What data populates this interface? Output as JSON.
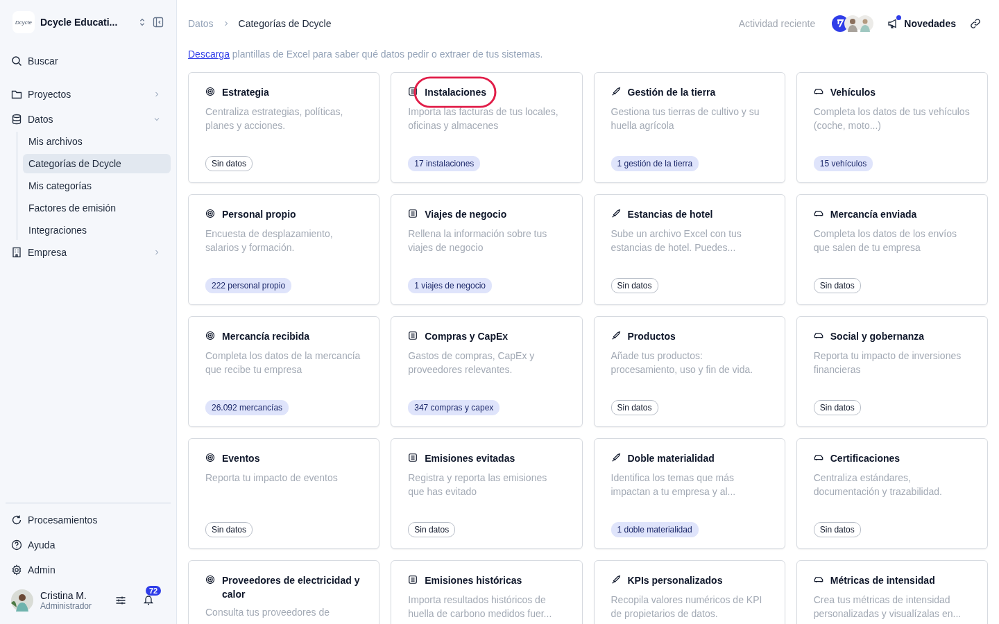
{
  "sidebar": {
    "workspace": {
      "logo": "Dcycle",
      "name": "Dcycle Educati..."
    },
    "search": "Buscar",
    "items": [
      {
        "label": "Proyectos",
        "expanded": false
      },
      {
        "label": "Datos",
        "expanded": true,
        "children": [
          {
            "label": "Mis archivos",
            "selected": false
          },
          {
            "label": "Categorías de Dcycle",
            "selected": true
          },
          {
            "label": "Mis categorías",
            "selected": false
          },
          {
            "label": "Factores de emisión",
            "selected": false
          },
          {
            "label": "Integraciones",
            "selected": false
          }
        ]
      },
      {
        "label": "Empresa",
        "expanded": false
      }
    ],
    "footer_items": [
      "Procesamientos",
      "Ayuda",
      "Admin"
    ],
    "user": {
      "name": "Cristina M.",
      "role": "Administrador",
      "notifications": "72"
    }
  },
  "breadcrumb": [
    "Datos",
    "Categorías de Dcycle"
  ],
  "header": {
    "activity": "Actividad reciente",
    "news": "Novedades",
    "news_unread": true
  },
  "notice": {
    "link": "Descarga",
    "text": " plantillas de Excel para saber qué datos pedir o extraer de tus sistemas."
  },
  "cards": [
    {
      "title": "Estrategia",
      "description": "Centraliza estrategias, políticas, planes y acciones.",
      "status": "Sin datos",
      "has_data": false
    },
    {
      "title": "Instalaciones",
      "description": "Importa las facturas de tus locales, oficinas y almacenes",
      "status": "17 instalaciones",
      "has_data": true,
      "highlighted": true
    },
    {
      "title": "Gestión de la tierra",
      "description": "Gestiona tus tierras de cultivo y su huella agrícola",
      "status": "1 gestión de la tierra",
      "has_data": true
    },
    {
      "title": "Vehículos",
      "description": "Completa los datos de tus vehículos (coche, moto...)",
      "status": "15 vehículos",
      "has_data": true
    },
    {
      "title": "Personal propio",
      "description": "Encuesta de desplazamiento, salarios y formación.",
      "status": "222 personal propio",
      "has_data": true
    },
    {
      "title": "Viajes de negocio",
      "description": "Rellena la información sobre tus viajes de negocio",
      "status": "1 viajes de negocio",
      "has_data": true
    },
    {
      "title": "Estancias de hotel",
      "description": "Sube un archivo Excel con tus estancias de hotel. Puedes...",
      "status": "Sin datos",
      "has_data": false
    },
    {
      "title": "Mercancía enviada",
      "description": "Completa los datos de los envíos que salen de tu empresa",
      "status": "Sin datos",
      "has_data": false
    },
    {
      "title": "Mercancía recibida",
      "description": "Completa los datos de la mercancía que recibe tu empresa",
      "status": "26.092 mercancías",
      "has_data": true
    },
    {
      "title": "Compras y CapEx",
      "description": "Gastos de compras, CapEx y proveedores relevantes.",
      "status": "347 compras y capex",
      "has_data": true
    },
    {
      "title": "Productos",
      "description": "Añade tus productos: procesamiento, uso y fin de vida.",
      "status": "Sin datos",
      "has_data": false
    },
    {
      "title": "Social y gobernanza",
      "description": "Reporta tu impacto de inversiones financieras",
      "status": "Sin datos",
      "has_data": false
    },
    {
      "title": "Eventos",
      "description": "Reporta tu impacto de eventos",
      "status": "Sin datos",
      "has_data": false
    },
    {
      "title": "Emisiones evitadas",
      "description": "Registra y reporta las emisiones que has evitado",
      "status": "Sin datos",
      "has_data": false
    },
    {
      "title": "Doble materialidad",
      "description": "Identifica los temas que más impactan a tu empresa y al...",
      "status": "1 doble materialidad",
      "has_data": true
    },
    {
      "title": "Certificaciones",
      "description": "Centraliza estándares, documentación y trazabilidad.",
      "status": "Sin datos",
      "has_data": false
    },
    {
      "title": "Proveedores de electricidad y calor",
      "description": "Consulta tus proveedores de"
    },
    {
      "title": "Emisiones históricas",
      "description": "Importa resultados históricos de huella de carbono medidos fuer..."
    },
    {
      "title": "KPIs personalizados",
      "description": "Recopila valores numéricos de KPI de propietarios de datos."
    },
    {
      "title": "Métricas de intensidad",
      "description": "Crea tus métricas de intensidad personalizadas y visualízalas en..."
    }
  ]
}
